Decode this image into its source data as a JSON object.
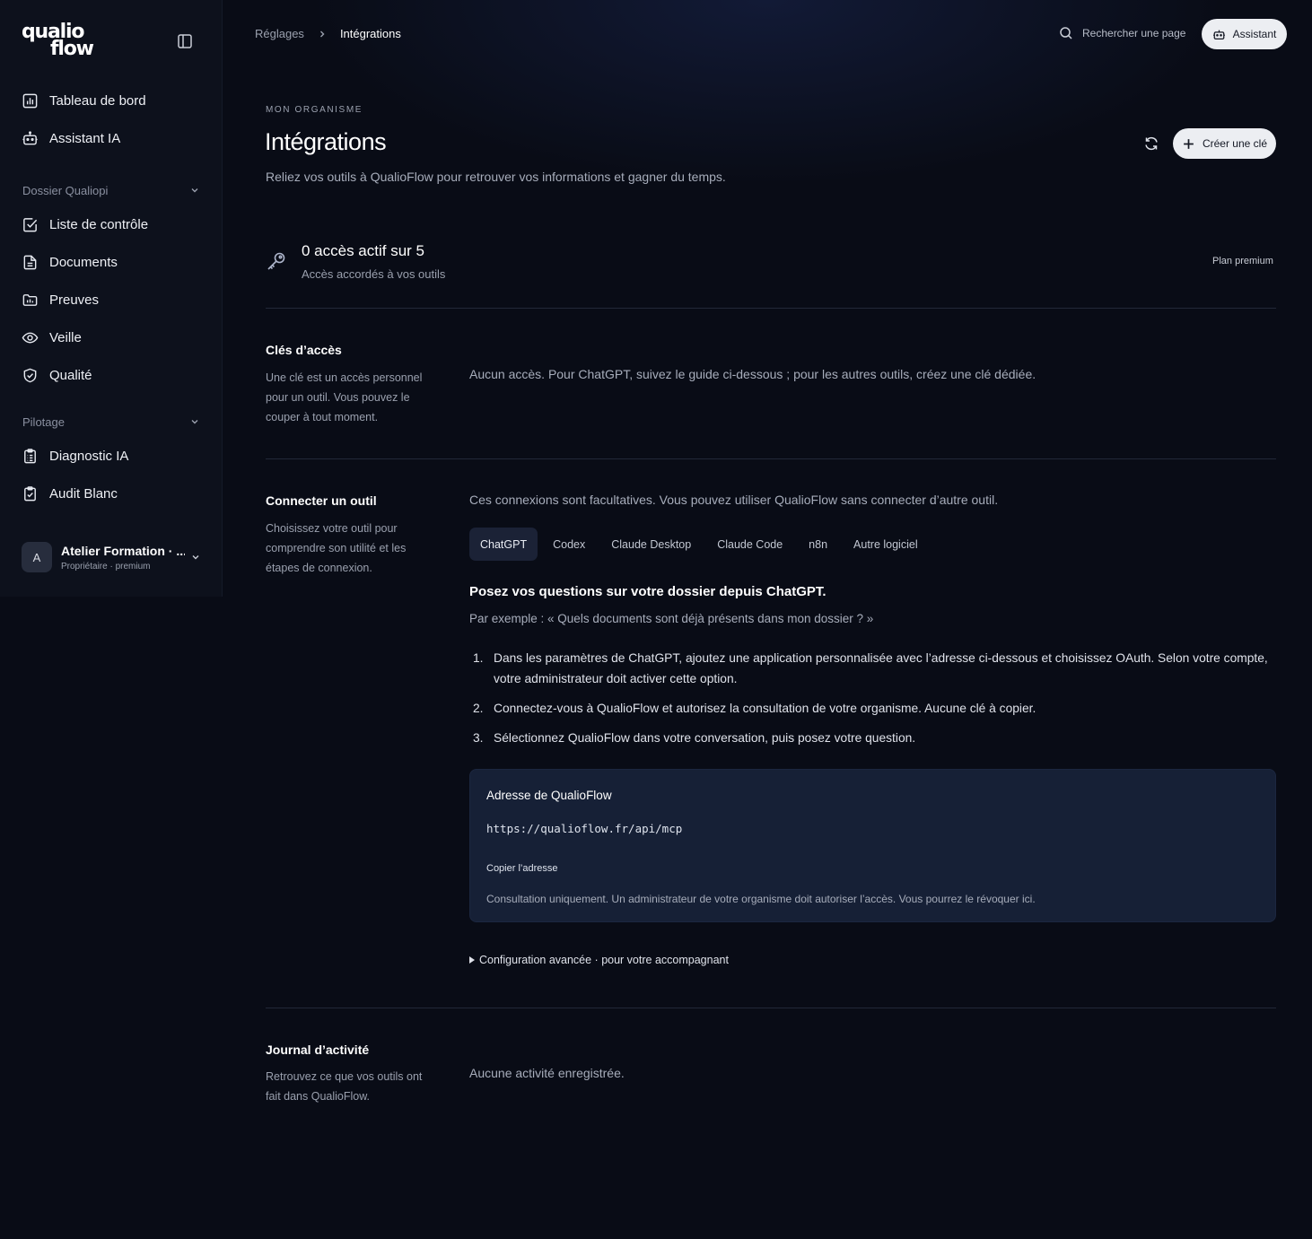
{
  "sidebar": {
    "logo_line1": "qualio",
    "logo_line2": "flow",
    "items_main": [
      {
        "label": "Tableau de bord",
        "icon": "chart-icon"
      },
      {
        "label": "Assistant IA",
        "icon": "robot-icon"
      }
    ],
    "section_qualiopi": "Dossier Qualiopi",
    "items_qualiopi": [
      {
        "label": "Liste de contrôle",
        "icon": "checkbox-icon"
      },
      {
        "label": "Documents",
        "icon": "document-icon"
      },
      {
        "label": "Preuves",
        "icon": "folder-icon"
      },
      {
        "label": "Veille",
        "icon": "eye-icon"
      },
      {
        "label": "Qualité",
        "icon": "shield-icon"
      }
    ],
    "section_pilotage": "Pilotage",
    "items_pilotage": [
      {
        "label": "Diagnostic IA",
        "icon": "clipboard-list-icon"
      },
      {
        "label": "Audit Blanc",
        "icon": "clipboard-check-icon"
      }
    ],
    "account": {
      "initial": "A",
      "name": "Atelier Formation · ...",
      "role": "Propriétaire · premium"
    }
  },
  "header": {
    "breadcrumb_parent": "Réglages",
    "breadcrumb_current": "Intégrations",
    "search_label": "Rechercher une page",
    "assistant_label": "Assistant"
  },
  "page": {
    "eyebrow": "MON ORGANISME",
    "title": "Intégrations",
    "subtitle": "Reliez vos outils à QualioFlow pour retrouver vos informations et gagner du temps.",
    "create_key_label": "Créer une clé"
  },
  "summary": {
    "count_text": "0 accès actif sur 5",
    "sub_text": "Accès accordés à vos outils",
    "plan": "Plan premium"
  },
  "keys_section": {
    "title": "Clés d’accès",
    "desc": "Une clé est un accès personnel pour un outil. Vous pouvez le couper à tout moment.",
    "empty": "Aucun accès. Pour ChatGPT, suivez le guide ci-dessous ; pour les autres outils, créez une clé dédiée."
  },
  "connect_section": {
    "title": "Connecter un outil",
    "desc": "Choisissez votre outil pour comprendre son utilité et les étapes de connexion.",
    "intro": "Ces connexions sont facultatives. Vous pouvez utiliser QualioFlow sans connecter d’autre outil.",
    "tabs": [
      "ChatGPT",
      "Codex",
      "Claude Desktop",
      "Claude Code",
      "n8n",
      "Autre logiciel"
    ],
    "active_tab": "ChatGPT",
    "headline": "Posez vos questions sur votre dossier depuis ChatGPT.",
    "example": "Par exemple : « Quels documents sont déjà présents dans mon dossier ? »",
    "steps": [
      {
        "num": "1.",
        "text": "Dans les paramètres de ChatGPT, ajoutez une application personnalisée avec l’adresse ci-dessous et choisissez OAuth. Selon votre compte, votre administrateur doit activer cette option."
      },
      {
        "num": "2.",
        "text": "Connectez-vous à QualioFlow et autorisez la consultation de votre organisme. Aucune clé à copier."
      },
      {
        "num": "3.",
        "text": "Sélectionnez QualioFlow dans votre conversation, puis posez votre question."
      }
    ],
    "address_card": {
      "title": "Adresse de QualioFlow",
      "url": "https://qualioflow.fr/api/mcp",
      "copy_label": "Copier l’adresse",
      "note": "Consultation uniquement. Un administrateur de votre organisme doit autoriser l’accès. Vous pourrez le révoquer ici."
    },
    "advanced_label": "Configuration avancée · pour votre accompagnant"
  },
  "journal_section": {
    "title": "Journal d’activité",
    "desc": "Retrouvez ce que vos outils ont fait dans QualioFlow.",
    "empty": "Aucune activité enregistrée."
  },
  "colors": {
    "background": "#090c16",
    "sidebar": "#0d111c",
    "card": "#162036",
    "active_tab": "#1b2236",
    "button": "#eceef2"
  }
}
